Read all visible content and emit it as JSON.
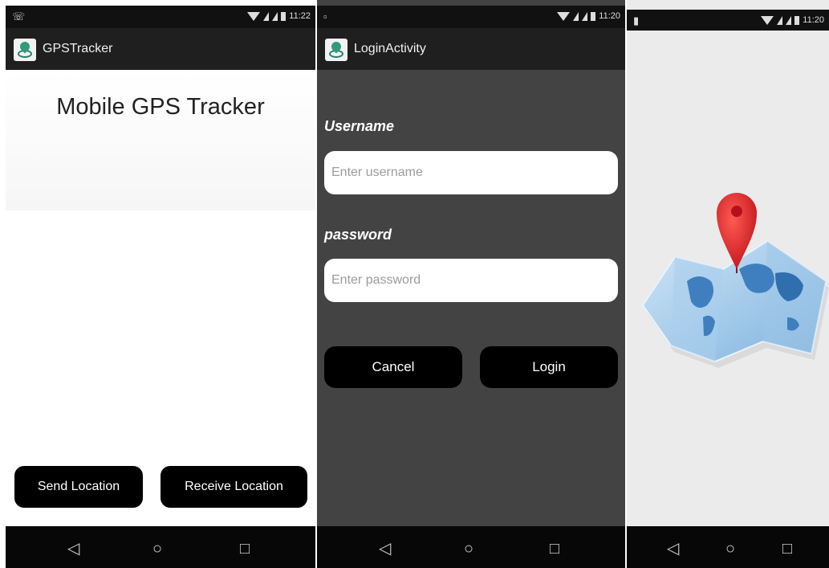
{
  "screen1": {
    "status_time": "11:22",
    "app_title": "GPSTracker",
    "heading": "Mobile GPS Tracker",
    "send_label": "Send Location",
    "receive_label": "Receive Location"
  },
  "screen2": {
    "status_time": "11:20",
    "app_title": "LoginActivity",
    "username_label": "Username",
    "username_placeholder": "Enter username",
    "password_label": "password",
    "password_placeholder": "Enter password",
    "cancel_label": "Cancel",
    "login_label": "Login"
  },
  "screen3": {
    "status_time": "11:20"
  },
  "nav": {
    "back": "◁",
    "home": "○",
    "recent": "□"
  },
  "colors": {
    "dark_bg": "#434343",
    "bar": "#1f1f1f",
    "button": "#000000",
    "pin": "#d8262b"
  }
}
